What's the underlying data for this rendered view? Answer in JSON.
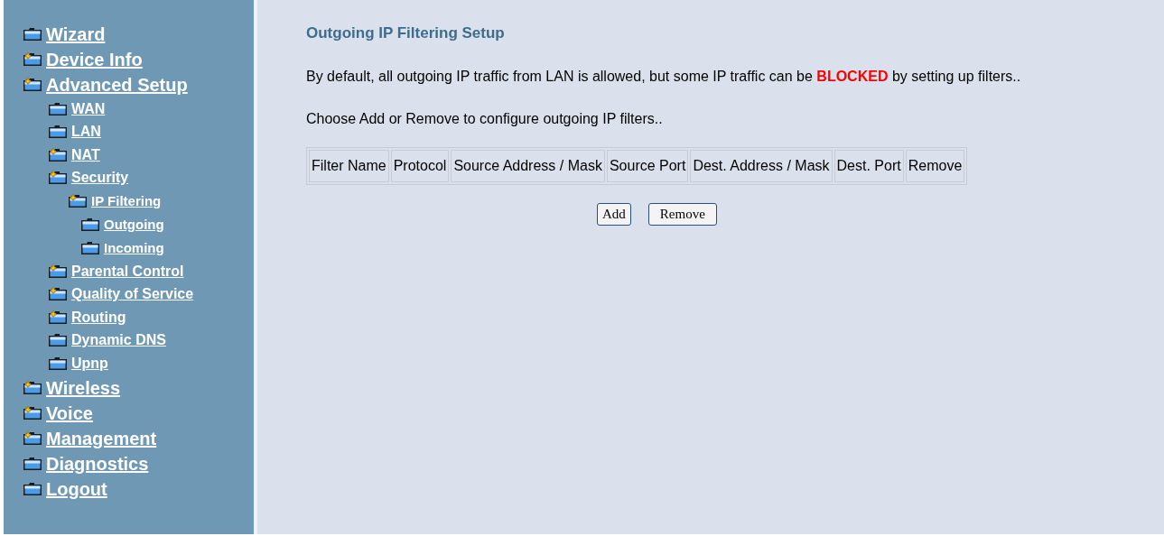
{
  "sidebar": {
    "items": [
      {
        "label": "Wizard",
        "expandable": false
      },
      {
        "label": "Device Info",
        "expandable": true
      },
      {
        "label": "Advanced Setup",
        "expandable": true,
        "children": [
          {
            "label": "WAN",
            "expandable": false
          },
          {
            "label": "LAN",
            "expandable": false
          },
          {
            "label": "NAT",
            "expandable": true
          },
          {
            "label": "Security",
            "expandable": true,
            "children": [
              {
                "label": "IP Filtering",
                "expandable": true,
                "children": [
                  {
                    "label": "Outgoing",
                    "expandable": false
                  },
                  {
                    "label": "Incoming",
                    "expandable": false
                  }
                ]
              }
            ]
          },
          {
            "label": "Parental Control",
            "expandable": true
          },
          {
            "label": "Quality of Service",
            "expandable": true
          },
          {
            "label": "Routing",
            "expandable": true
          },
          {
            "label": "Dynamic DNS",
            "expandable": false
          },
          {
            "label": "Upnp",
            "expandable": false
          }
        ]
      },
      {
        "label": "Wireless",
        "expandable": true
      },
      {
        "label": "Voice",
        "expandable": true
      },
      {
        "label": "Management",
        "expandable": true
      },
      {
        "label": "Diagnostics",
        "expandable": false
      },
      {
        "label": "Logout",
        "expandable": false
      }
    ]
  },
  "main": {
    "title": "Outgoing IP Filtering Setup",
    "description": "By default, all outgoing IP traffic from LAN is allowed, but some IP traffic can be **BLOCKED** by setting up filters..",
    "instruction": "Choose Add or Remove to configure outgoing IP filters..",
    "table": {
      "columns": [
        "Filter Name",
        "Protocol",
        "Source Address / Mask",
        "Source Port",
        "Dest. Address / Mask",
        "Dest. Port",
        "Remove"
      ]
    },
    "buttons": [
      "Add",
      "Remove"
    ]
  }
}
